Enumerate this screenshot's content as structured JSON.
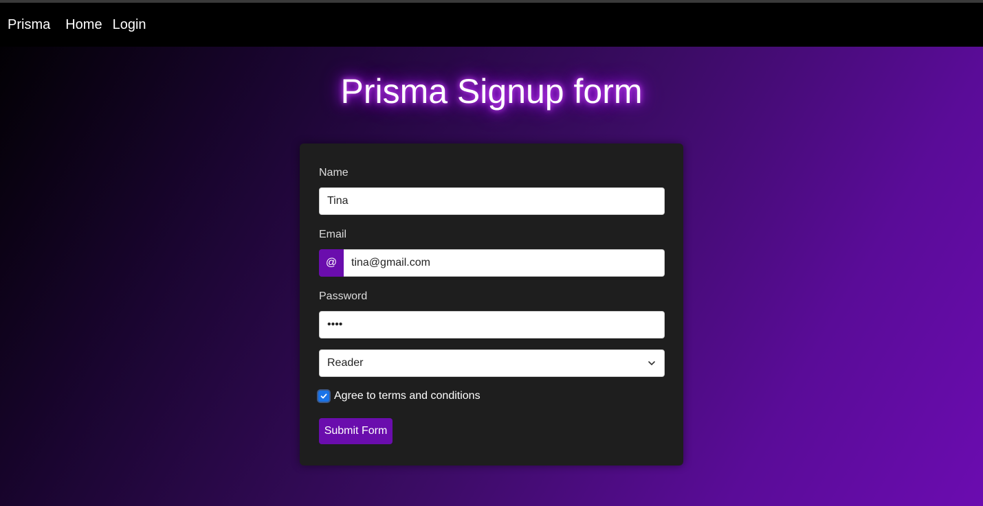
{
  "nav": {
    "brand": "Prisma",
    "links": [
      "Home",
      "Login"
    ]
  },
  "page": {
    "title": "Prisma Signup form"
  },
  "form": {
    "name_label": "Name",
    "name_value": "Tina",
    "email_label": "Email",
    "email_addon": "@",
    "email_value": "tina@gmail.com",
    "password_label": "Password",
    "password_value": "••••",
    "role_selected": "Reader",
    "agree_label": "Agree to terms and conditions",
    "agree_checked": true,
    "submit_label": "Submit Form"
  },
  "colors": {
    "accent": "#6a0dad",
    "checkbox": "#1a73e8",
    "card_bg": "#1e1e1e",
    "nav_bg": "#000000"
  }
}
